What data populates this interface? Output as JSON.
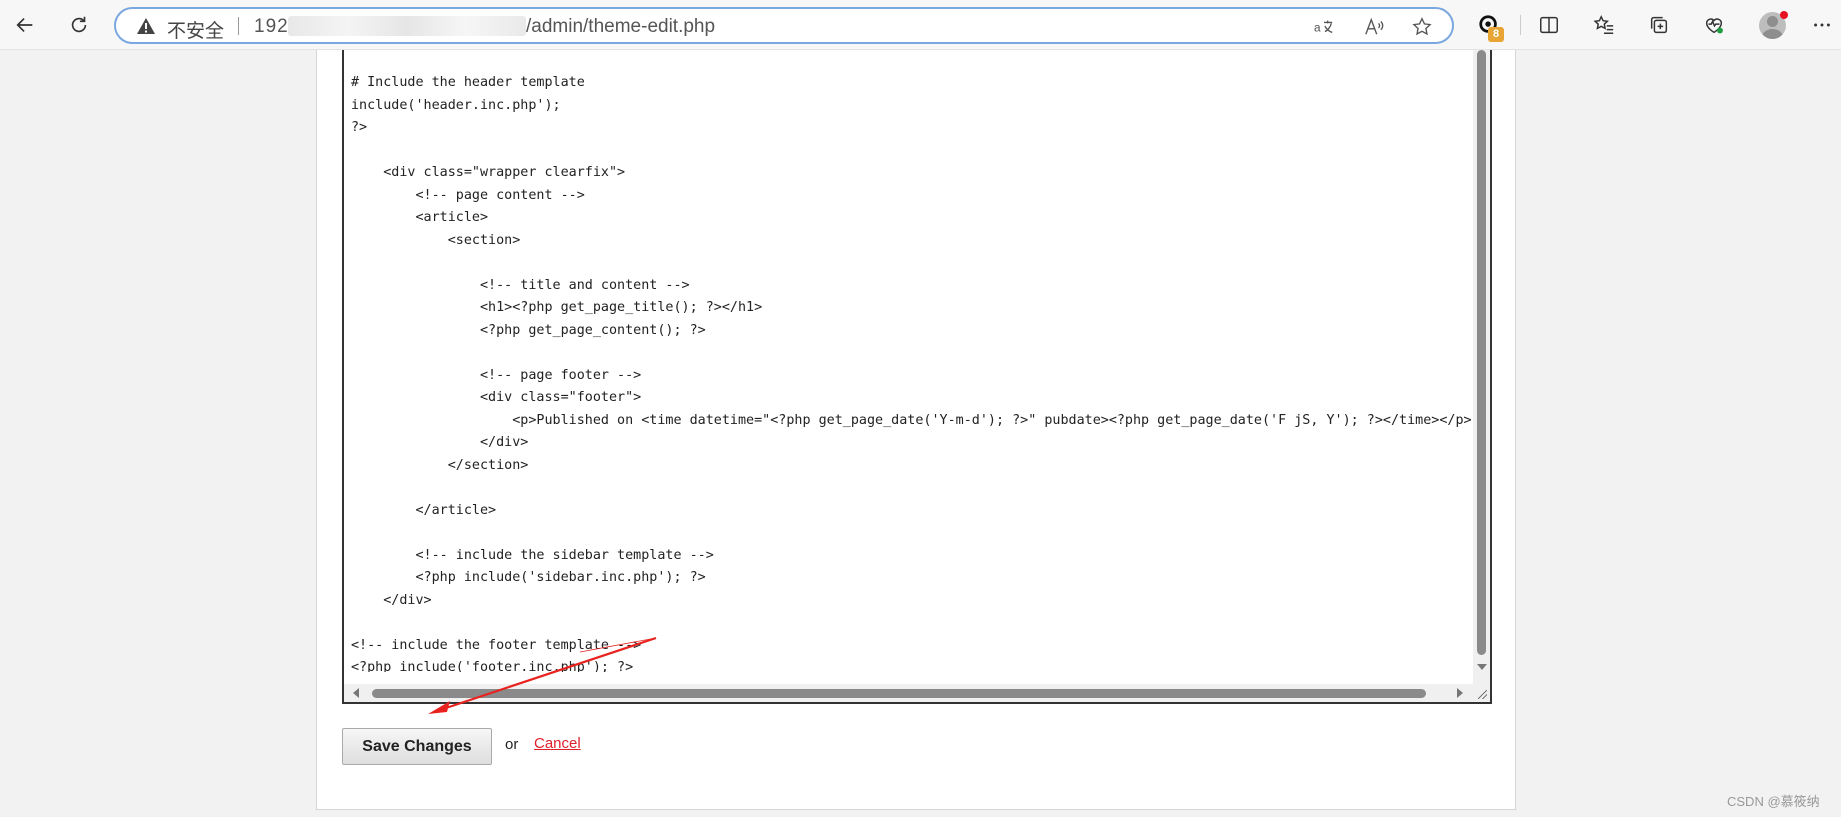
{
  "browser": {
    "security_label": "不安全",
    "host_prefix": "192.",
    "url_path": "/admin/theme-edit.php",
    "extension_badge": "8"
  },
  "editor": {
    "code": "# Include the header template\ninclude('header.inc.php');\n?>\n\n    <div class=\"wrapper clearfix\">\n        <!-- page content -->\n        <article>\n            <section>\n\n                <!-- title and content -->\n                <h1><?php get_page_title(); ?></h1>\n                <?php get_page_content(); ?>\n\n                <!-- page footer -->\n                <div class=\"footer\">\n                    <p>Published on <time datetime=\"<?php get_page_date('Y-m-d'); ?>\" pubdate><?php get_page_date('F jS, Y'); ?></time></p>\n                </div>\n            </section>\n\n        </article>\n\n        <!-- include the sidebar template -->\n        <?php include('sidebar.inc.php'); ?>\n    </div>\n\n<!-- include the footer template -->\n<?php include('footer.inc.php'); ?>"
  },
  "form": {
    "save_label": "Save Changes",
    "or_label": "or",
    "cancel_label": "Cancel"
  },
  "watermark": "CSDN @慕筱纳",
  "colors": {
    "annotation_arrow": "#e8231f",
    "cancel_link": "#e0202a",
    "address_focus": "#7aa7df"
  }
}
